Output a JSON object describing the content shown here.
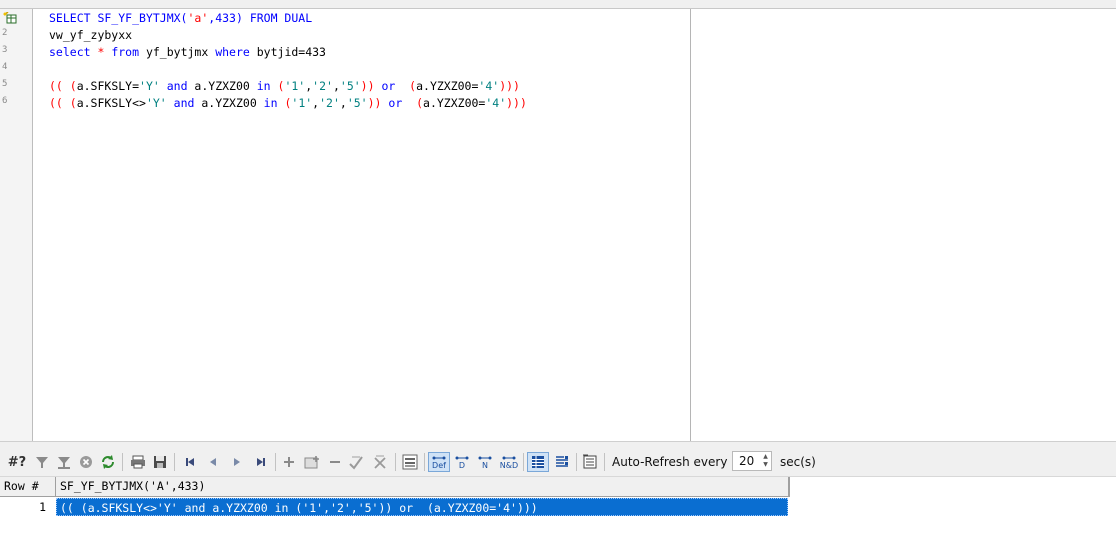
{
  "editor": {
    "line_numbers": [
      "2",
      "3",
      "4",
      "5",
      "6"
    ],
    "lines": [
      [
        {
          "t": "SELECT SF_YF_BYTJMX(",
          "c": "kw"
        },
        {
          "t": "'a'",
          "c": "red"
        },
        {
          "t": ",433) ",
          "c": "kw"
        },
        {
          "t": "FROM DUAL",
          "c": "kw"
        }
      ],
      [
        {
          "t": "vw_yf_zybyxx",
          "c": "txt"
        }
      ],
      [
        {
          "t": "select ",
          "c": "kw"
        },
        {
          "t": "* ",
          "c": "red"
        },
        {
          "t": "from ",
          "c": "kw"
        },
        {
          "t": "yf_bytjmx ",
          "c": "txt"
        },
        {
          "t": "where ",
          "c": "kw"
        },
        {
          "t": "bytjid=433",
          "c": "txt"
        }
      ],
      [
        {
          "t": "",
          "c": "txt"
        }
      ],
      [
        {
          "t": "(( (",
          "c": "red"
        },
        {
          "t": "a.SFKSLY=",
          "c": "txt"
        },
        {
          "t": "'Y' ",
          "c": "str"
        },
        {
          "t": "and ",
          "c": "kw"
        },
        {
          "t": "a.YZXZ00 ",
          "c": "txt"
        },
        {
          "t": "in ",
          "c": "kw"
        },
        {
          "t": "(",
          "c": "red"
        },
        {
          "t": "'1'",
          "c": "str"
        },
        {
          "t": ",",
          "c": "txt"
        },
        {
          "t": "'2'",
          "c": "str"
        },
        {
          "t": ",",
          "c": "txt"
        },
        {
          "t": "'5'",
          "c": "str"
        },
        {
          "t": ")) ",
          "c": "red"
        },
        {
          "t": "or  ",
          "c": "kw"
        },
        {
          "t": "(",
          "c": "red"
        },
        {
          "t": "a.YZXZ00=",
          "c": "txt"
        },
        {
          "t": "'4'",
          "c": "str"
        },
        {
          "t": ")))",
          "c": "red"
        }
      ],
      [
        {
          "t": "(( (",
          "c": "red"
        },
        {
          "t": "a.SFKSLY<>",
          "c": "txt"
        },
        {
          "t": "'Y' ",
          "c": "str"
        },
        {
          "t": "and ",
          "c": "kw"
        },
        {
          "t": "a.YZXZ00 ",
          "c": "txt"
        },
        {
          "t": "in ",
          "c": "kw"
        },
        {
          "t": "(",
          "c": "red"
        },
        {
          "t": "'1'",
          "c": "str"
        },
        {
          "t": ",",
          "c": "txt"
        },
        {
          "t": "'2'",
          "c": "str"
        },
        {
          "t": ",",
          "c": "txt"
        },
        {
          "t": "'5'",
          "c": "str"
        },
        {
          "t": ")) ",
          "c": "red"
        },
        {
          "t": "or  ",
          "c": "kw"
        },
        {
          "t": "(",
          "c": "red"
        },
        {
          "t": "a.YZXZ00=",
          "c": "txt"
        },
        {
          "t": "'4'",
          "c": "str"
        },
        {
          "t": ")))",
          "c": "red"
        }
      ]
    ]
  },
  "toolbar": {
    "help_label": "#?",
    "auto_refresh_label": "Auto-Refresh every",
    "refresh_interval": "20",
    "unit_label": "sec(s)",
    "def_label": "Def",
    "d_label": "D",
    "n_label": "N",
    "nd_label": "N&D"
  },
  "grid": {
    "row_header": "Row #",
    "column": "SF_YF_BYTJMX('A',433)",
    "rows": [
      {
        "num": "1",
        "value": "(( (a.SFKSLY<>'Y' and a.YZXZ00 in ('1','2','5')) or  (a.YZXZ00='4')))"
      }
    ]
  },
  "colors": {
    "keyword": "#0000ff",
    "string": "#008080",
    "operator": "#ff0000",
    "selection": "#0a6ed1"
  }
}
